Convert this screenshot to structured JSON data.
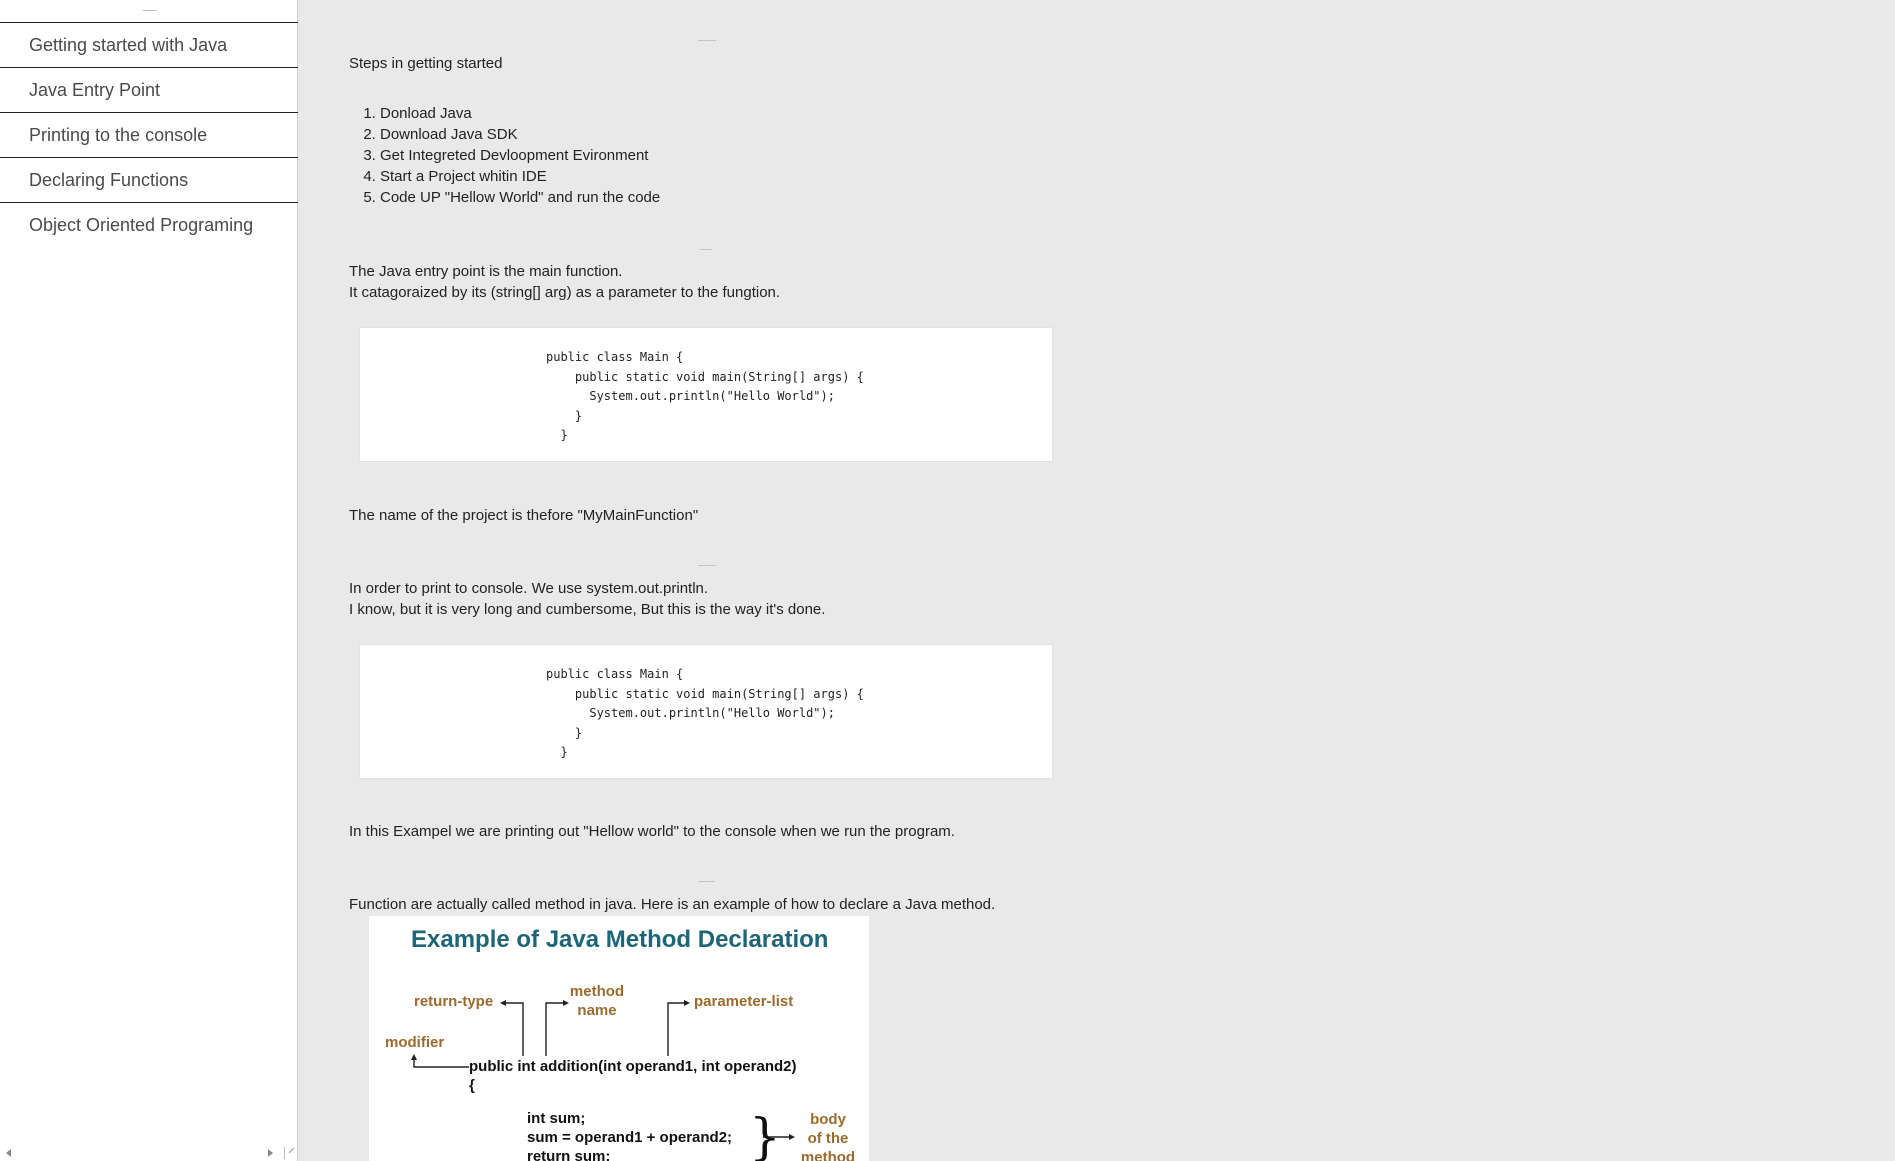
{
  "sidebar": {
    "items": [
      {
        "label": "Getting started with Java"
      },
      {
        "label": "Java Entry Point"
      },
      {
        "label": "Printing to the console"
      },
      {
        "label": "Declaring Functions"
      },
      {
        "label": "Object Oriented Programing"
      }
    ]
  },
  "sections": {
    "getting_started": {
      "heading": "Steps in getting started",
      "steps": [
        "Donload Java",
        "Download Java SDK",
        "Get Integreted Devloopment Evironment",
        "Start a Project whitin IDE",
        "Code UP \"Hellow World\" and run the code"
      ]
    },
    "entry_point": {
      "line1": "The Java entry point is the main function.",
      "line2": "It catagoraized by its (string[] arg) as a parameter to the fungtion.",
      "code": "public class Main {\n    public static void main(String[] args) {\n      System.out.println(\"Hello World\");\n    }\n  }",
      "note": "The name of the project is thefore \"MyMainFunction\""
    },
    "printing": {
      "line1": "In order to print to console. We use system.out.println.",
      "line2": "I know, but it is very long and cumbersome, But this is the way it's done.",
      "code": "public class Main {\n    public static void main(String[] args) {\n      System.out.println(\"Hello World\");\n    }\n  }",
      "note": "In this Exampel we are printing out \"Hellow world\" to the console when we run the program."
    },
    "functions": {
      "line1": "Function are actually called method in java. Here is an example of how to declare a Java method.",
      "diagram": {
        "title": "Example of Java Method Declaration",
        "return_type": "return-type",
        "method_name_1": "method",
        "method_name_2": "name",
        "parameter_list": "parameter-list",
        "modifier": "modifier",
        "signature": "public int addition(int operand1, int operand2)",
        "open_brace": "{",
        "body_line1": "int sum;",
        "body_line2": "sum = operand1 + operand2;",
        "body_line3": "return sum;",
        "body_label_1": "body",
        "body_label_2": "of the",
        "body_label_3": "method"
      }
    }
  },
  "colors": {
    "page_bg": "#e9e9e9",
    "sidebar_bg": "#ffffff",
    "diagram_title": "#1e6677",
    "diagram_label": "#9b6a2f"
  }
}
